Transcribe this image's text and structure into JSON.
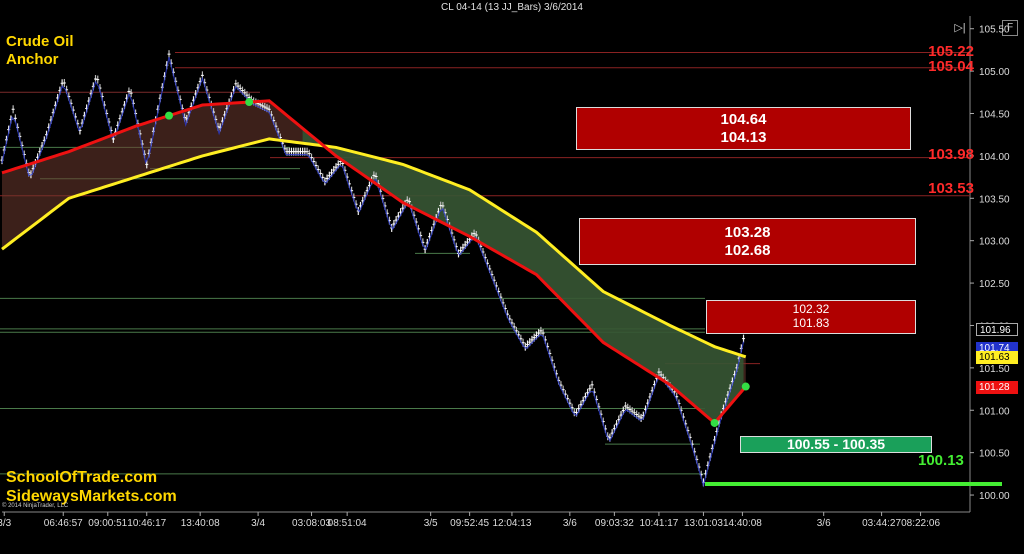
{
  "title": "CL 04-14 (13 JJ_Bars)  3/6/2014",
  "labels": {
    "line1": "Crude Oil",
    "line2": "Anchor",
    "brand1": "SchoolOfTrade.com",
    "brand2": "SidewaysMarkets.com",
    "copyright": "© 2014 NinjaTrader, LLC",
    "f_button": "F",
    "corner_icon": "▷|"
  },
  "colors": {
    "background": "#000000",
    "zone_red": "#b00000",
    "zone_green": "#1aa05a",
    "level_red": "#ff2a2a",
    "level_green": "#44ee33",
    "ema_yellow": "#ffee22",
    "ema_red": "#ee1111",
    "ribbon_green": "#2f5a34",
    "ribbon_brown": "#6e3a30"
  },
  "chart_data": {
    "type": "line",
    "ylim": [
      99.8,
      105.65
    ],
    "y_ticks": [
      "105.50",
      "105.00",
      "104.50",
      "104.00",
      "103.50",
      "103.00",
      "102.50",
      "102.00",
      "101.50",
      "101.00",
      "100.50",
      "100.00"
    ],
    "y_tick_values": [
      105.5,
      105.0,
      104.5,
      104.0,
      103.5,
      103.0,
      102.5,
      102.0,
      101.5,
      101.0,
      100.5,
      100.0
    ],
    "x_ticks": [
      "3/3",
      "06:46:57",
      "09:00:51",
      "10:46:17",
      "13:40:08",
      "3/4",
      "03:08:03",
      "08:51:04",
      "3/5",
      "09:52:45",
      "12:04:13",
      "3/6",
      "09:03:32",
      "10:41:17",
      "13:01:03",
      "14:40:08",
      "3/6",
      "03:44:27",
      "08:22:06"
    ],
    "x_tick_index": [
      2,
      55,
      95,
      130,
      178,
      230,
      278,
      310,
      385,
      420,
      458,
      510,
      550,
      590,
      630,
      665,
      738,
      790,
      825
    ],
    "n_bars": 680,
    "price_path": [
      [
        0,
        103.95
      ],
      [
        10,
        104.55
      ],
      [
        25,
        103.75
      ],
      [
        40,
        104.25
      ],
      [
        55,
        104.9
      ],
      [
        70,
        104.3
      ],
      [
        85,
        104.95
      ],
      [
        100,
        104.2
      ],
      [
        115,
        104.8
      ],
      [
        130,
        103.9
      ],
      [
        150,
        105.2
      ],
      [
        165,
        104.4
      ],
      [
        180,
        104.95
      ],
      [
        195,
        104.3
      ],
      [
        210,
        104.85
      ],
      [
        225,
        104.65
      ],
      [
        240,
        104.55
      ],
      [
        255,
        104.05
      ],
      [
        275,
        104.05
      ],
      [
        290,
        103.7
      ],
      [
        305,
        103.95
      ],
      [
        320,
        103.35
      ],
      [
        335,
        103.8
      ],
      [
        350,
        103.15
      ],
      [
        365,
        103.5
      ],
      [
        380,
        102.9
      ],
      [
        395,
        103.45
      ],
      [
        410,
        102.85
      ],
      [
        425,
        103.1
      ],
      [
        440,
        102.6
      ],
      [
        455,
        102.1
      ],
      [
        470,
        101.75
      ],
      [
        485,
        101.95
      ],
      [
        500,
        101.35
      ],
      [
        515,
        100.95
      ],
      [
        530,
        101.3
      ],
      [
        545,
        100.65
      ],
      [
        560,
        101.05
      ],
      [
        575,
        100.9
      ],
      [
        590,
        101.45
      ],
      [
        605,
        101.2
      ],
      [
        620,
        100.6
      ],
      [
        630,
        100.15
      ],
      [
        645,
        100.9
      ],
      [
        660,
        101.5
      ],
      [
        668,
        101.96
      ]
    ],
    "series": [
      {
        "values": [
          [
            0,
            103.8
          ],
          [
            60,
            104.05
          ],
          [
            120,
            104.35
          ],
          [
            180,
            104.6
          ],
          [
            240,
            104.65
          ],
          [
            300,
            104.0
          ],
          [
            360,
            103.45
          ],
          [
            420,
            103.05
          ],
          [
            480,
            102.6
          ],
          [
            540,
            101.8
          ],
          [
            600,
            101.3
          ],
          [
            640,
            100.85
          ],
          [
            668,
            101.28
          ]
        ]
      },
      {
        "values": [
          [
            0,
            102.9
          ],
          [
            60,
            103.5
          ],
          [
            120,
            103.75
          ],
          [
            180,
            104.0
          ],
          [
            240,
            104.2
          ],
          [
            300,
            104.1
          ],
          [
            360,
            103.9
          ],
          [
            420,
            103.6
          ],
          [
            480,
            103.1
          ],
          [
            540,
            102.4
          ],
          [
            600,
            102.0
          ],
          [
            640,
            101.75
          ],
          [
            668,
            101.63
          ]
        ]
      }
    ],
    "horizontal_levels": [
      {
        "y": 105.22,
        "label": "105.22",
        "color": "#ff2a2a"
      },
      {
        "y": 105.04,
        "label": "105.04",
        "color": "#ff2a2a"
      },
      {
        "y": 103.98,
        "label": "103.98",
        "color": "#ff2a2a"
      },
      {
        "y": 103.53,
        "label": "103.53",
        "color": "#ff2a2a"
      },
      {
        "y": 100.13,
        "label": "100.13",
        "color": "#44ee33"
      }
    ],
    "zones": [
      {
        "top": "104.64",
        "bottom": "104.13"
      },
      {
        "top": "103.28",
        "bottom": "102.68"
      },
      {
        "top": "102.32",
        "bottom": "101.83"
      }
    ],
    "support_zone": "100.55 - 100.35",
    "price_tags": [
      {
        "value": "101.96",
        "bg": "#000000",
        "fg": "#ffffff",
        "y": 101.96
      },
      {
        "value": "101.74",
        "bg": "#2233cc",
        "fg": "#ffffff",
        "y": 101.74
      },
      {
        "value": "101.63",
        "bg": "#ffee22",
        "fg": "#000000",
        "y": 101.63
      },
      {
        "value": "101.28",
        "bg": "#ee1111",
        "fg": "#ffffff",
        "y": 101.28
      }
    ]
  }
}
